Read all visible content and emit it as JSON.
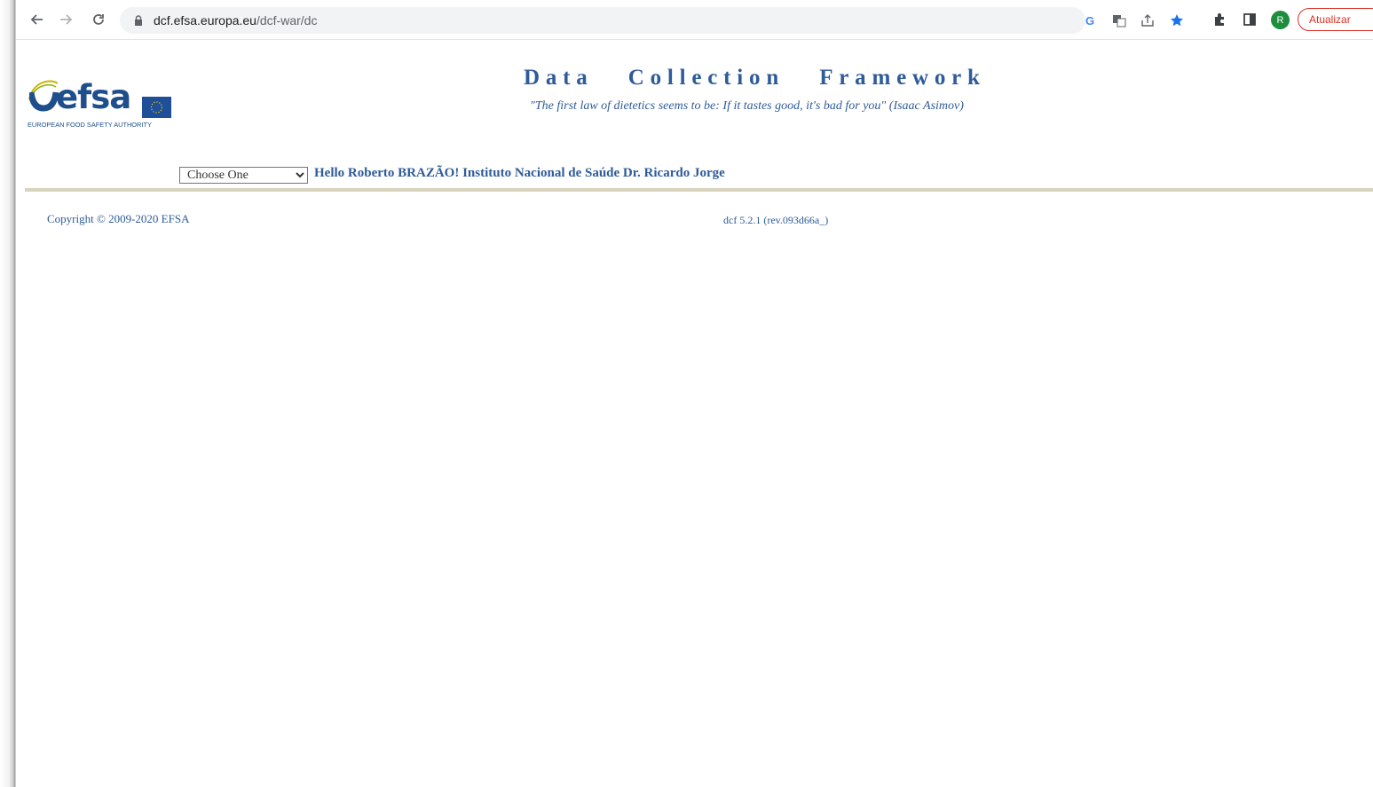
{
  "browser": {
    "url_host": "dcf.efsa.europa.eu",
    "url_path": "/dcf-war/dc",
    "profile_initial": "R",
    "update_label": "Atualizar",
    "icons": [
      "back-icon",
      "forward-icon",
      "reload-icon",
      "lock-icon",
      "google-icon",
      "translate-icon",
      "share-icon",
      "star-icon",
      "extensions-icon",
      "side-panel-icon",
      "avatar",
      "menu-icon"
    ],
    "colors": {
      "star": "#1a73e8",
      "update": "#d93025",
      "avatar": "#1e8e3e"
    }
  },
  "logo": {
    "wordmark": "efsa",
    "tagline": "EUROPEAN FOOD SAFETY AUTHORITY"
  },
  "header": {
    "title": "Data   Collection   Framework",
    "quote": "\"The first law of dietetics seems to be: If it tastes good, it's bad for you\" (Isaac Asimov)"
  },
  "nav": {
    "select_value": "Choose One",
    "greeting": "Hello Roberto BRAZÃO! Instituto Nacional de Saúde Dr. Ricardo Jorge"
  },
  "footer": {
    "copyright": "Copyright © 2009-2020 EFSA",
    "version": "dcf 5.2.1 (rev.093d66a_)"
  },
  "colors": {
    "text_blue": "#2e5b99",
    "divider": "#d8d3bd"
  }
}
